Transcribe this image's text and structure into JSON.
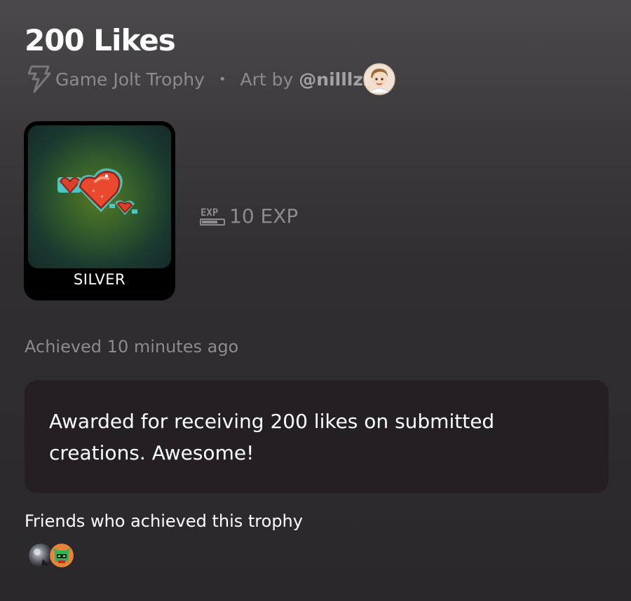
{
  "trophy": {
    "title": "200 Likes",
    "type_label": "Game Jolt Trophy",
    "separator": "•",
    "art_by_label": "Art by",
    "artist_handle": "@nilllzz",
    "tier": "SILVER",
    "exp_value": "10 EXP",
    "achieved_text": "Achieved 10 minutes ago",
    "description": "Awarded for receiving 200 likes on submitted creations. Awesome!"
  },
  "friends": {
    "label": "Friends who achieved this trophy",
    "avatars": [
      {
        "icon": "friend-avatar-1"
      },
      {
        "icon": "friend-avatar-2"
      }
    ]
  },
  "colors": {
    "heart_red": "#e8492f",
    "heart_outline": "#4fc6c6",
    "muted_text": "#8d8b8d",
    "card_bg": "#231f23"
  }
}
